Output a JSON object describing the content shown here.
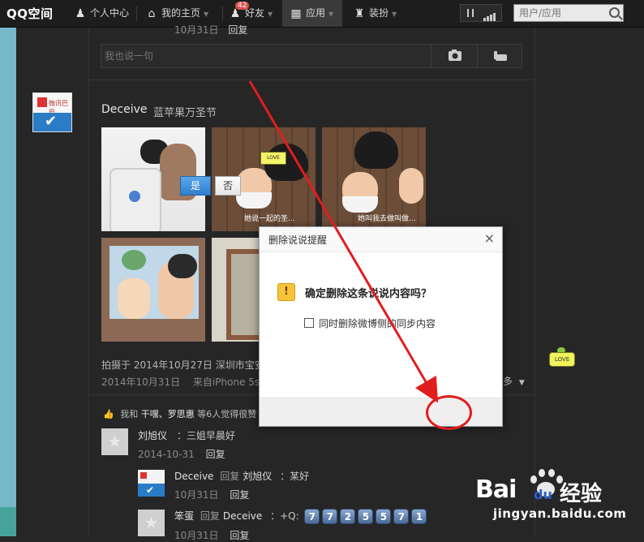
{
  "topbar": {
    "logo": "QQ空间",
    "nav": [
      {
        "label": "个人中心",
        "icon": "person-icon"
      },
      {
        "label": "我的主页",
        "icon": "home-icon"
      },
      {
        "label": "好友",
        "icon": "friends-icon",
        "badge": "42"
      },
      {
        "label": "应用",
        "icon": "apps-grid-icon"
      },
      {
        "label": "装扮",
        "icon": "shirt-icon"
      }
    ],
    "search_placeholder": "用户/应用"
  },
  "previous_post": {
    "date": "10月31日",
    "reply": "回复",
    "input_placeholder": "我也说一句"
  },
  "post": {
    "avatar_text": "微讯巴巴",
    "author": "Deceive",
    "text": "蓝苹果万圣节",
    "photo_caption_1": "她说一起的圣...",
    "photo_caption_2": "她叫我去做叫做...",
    "meta_location": "拍摄于 2014年10月27日  深圳市宝安",
    "date": "2014年10月31日",
    "source": "来自iPhone 5s",
    "more_label": "多",
    "likes_prefix": "我和",
    "likes_names": "干嘿、罗思惠",
    "likes_suffix": "等6人觉得很赞"
  },
  "comments": [
    {
      "name": "刘旭仪",
      "text": "：三姐早晨好",
      "date": "2014-10-31",
      "reply": "回复"
    },
    {
      "name": "Deceive",
      "reply_word": "回复",
      "target": "刘旭仪",
      "text": "：某好",
      "date": "10月31日",
      "reply": "回复"
    },
    {
      "name": "笨蛋",
      "reply_word": "回复",
      "target": "Deceive",
      "text": "：+Q:",
      "digits": [
        "7",
        "7",
        "2",
        "5",
        "5",
        "7",
        "1"
      ],
      "date": "10月31日",
      "reply": "回复"
    }
  ],
  "love_sticker": "LOVE",
  "dialog": {
    "title": "删除说说提醒",
    "close": "×",
    "warning_glyph": "!",
    "message": "确定删除这条说说内容吗？",
    "checkbox_label": "同时删除微博侧的同步内容",
    "yes": "是",
    "no": "否"
  },
  "watermark": {
    "brand_bai": "Bai",
    "brand_du": "du",
    "brand_jingyan": "经验",
    "url": "jingyan.baidu.com"
  },
  "colors": {
    "accent_blue": "#2f7fcf",
    "annotation_red": "#e21d1d",
    "background": "#262626"
  }
}
